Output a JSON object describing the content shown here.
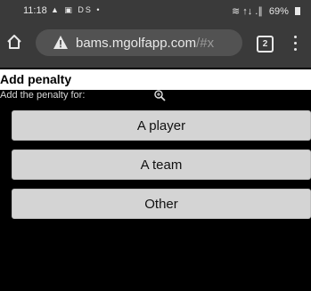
{
  "status_bar": {
    "time": "11:18",
    "left_icons": "▲ ▣ DS •",
    "signal": "≋ ↑↓ .∥",
    "battery": "69%"
  },
  "browser": {
    "url_host": "bams.mgolfapp.com",
    "url_suffix": "/#x",
    "tab_count": "2"
  },
  "page": {
    "title": "Add penalty",
    "subtitle": "Add the penalty for:"
  },
  "options": [
    {
      "label": "A player"
    },
    {
      "label": "A team"
    },
    {
      "label": "Other"
    }
  ]
}
